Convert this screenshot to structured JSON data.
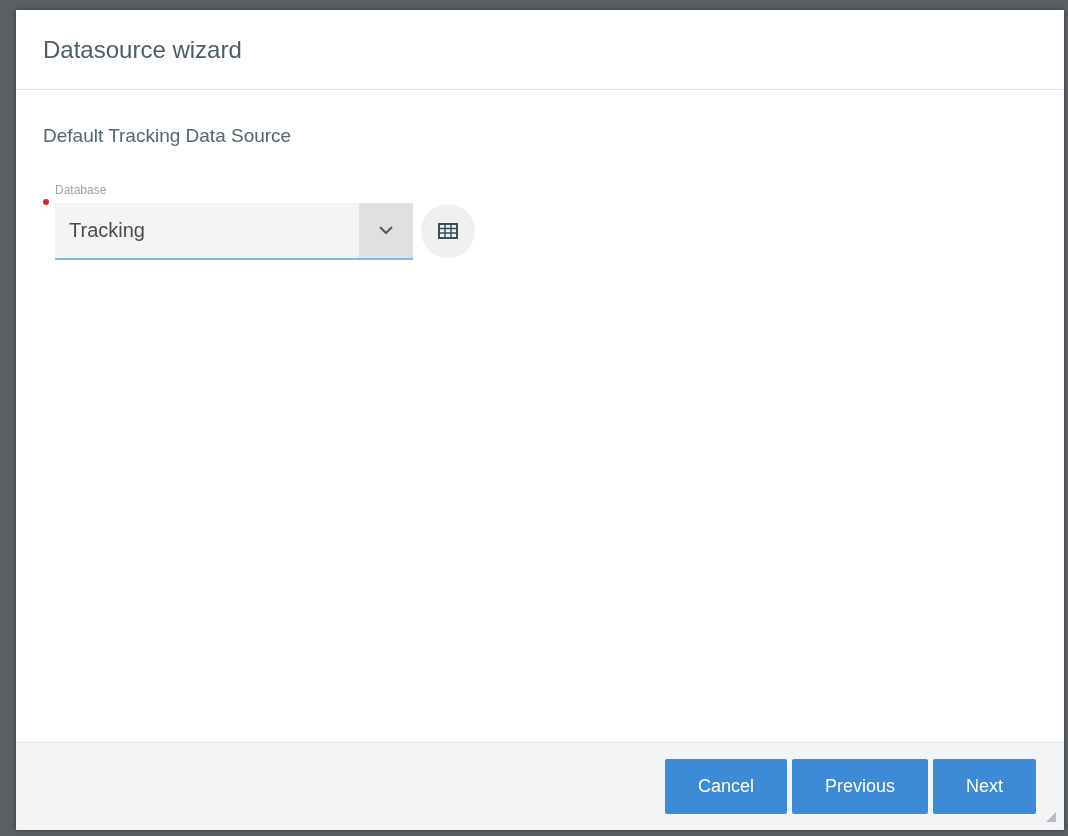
{
  "dialog": {
    "title": "Datasource wizard"
  },
  "section": {
    "title": "Default Tracking Data Source"
  },
  "field": {
    "label": "Database",
    "value": "Tracking",
    "required": true,
    "focused": true
  },
  "buttons": [
    {
      "label": "Cancel"
    },
    {
      "label": "Previous"
    },
    {
      "label": "Next"
    }
  ]
}
